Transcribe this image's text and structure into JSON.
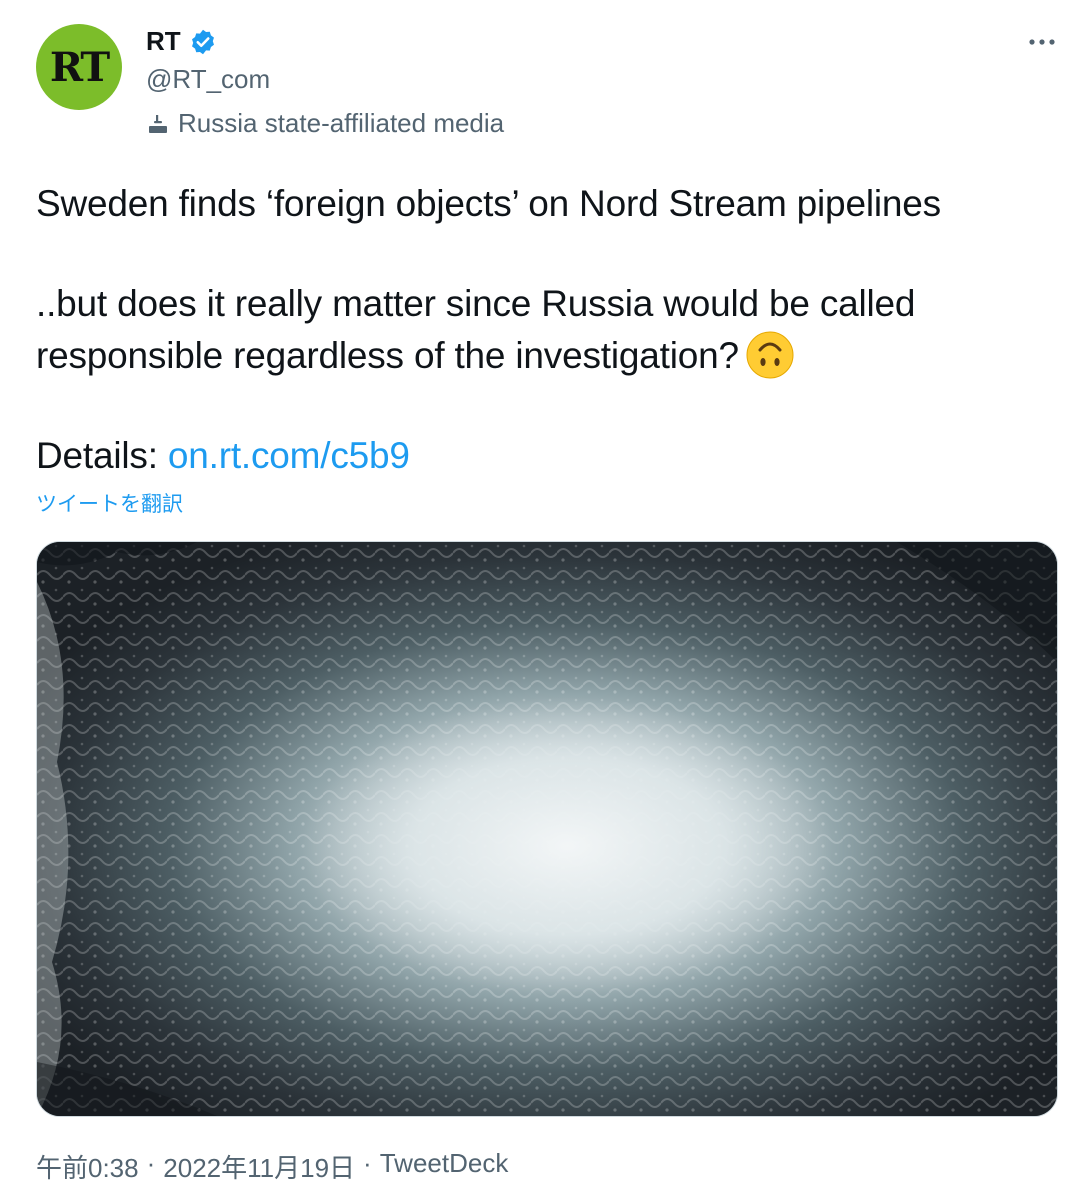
{
  "author": {
    "avatar_text": "RT",
    "name": "RT",
    "handle": "@RT_com",
    "label": "Russia state-affiliated media"
  },
  "tweet": {
    "line1": "Sweden finds ‘foreign objects’ on Nord Stream pipelines",
    "line2": "..but does it really matter since Russia would be called responsible regardless of the investigation?",
    "details_label": "Details:",
    "link": "on.rt.com/c5b9"
  },
  "translate_label": "ツイートを翻訳",
  "meta": {
    "time": "午前0:38",
    "sep1": "·",
    "date": "2022年11月19日",
    "sep2": "·",
    "source": "TweetDeck"
  },
  "colors": {
    "avatar_bg": "#7cbd2a",
    "link": "#1d9bf0",
    "verified": "#1d9bf0"
  }
}
